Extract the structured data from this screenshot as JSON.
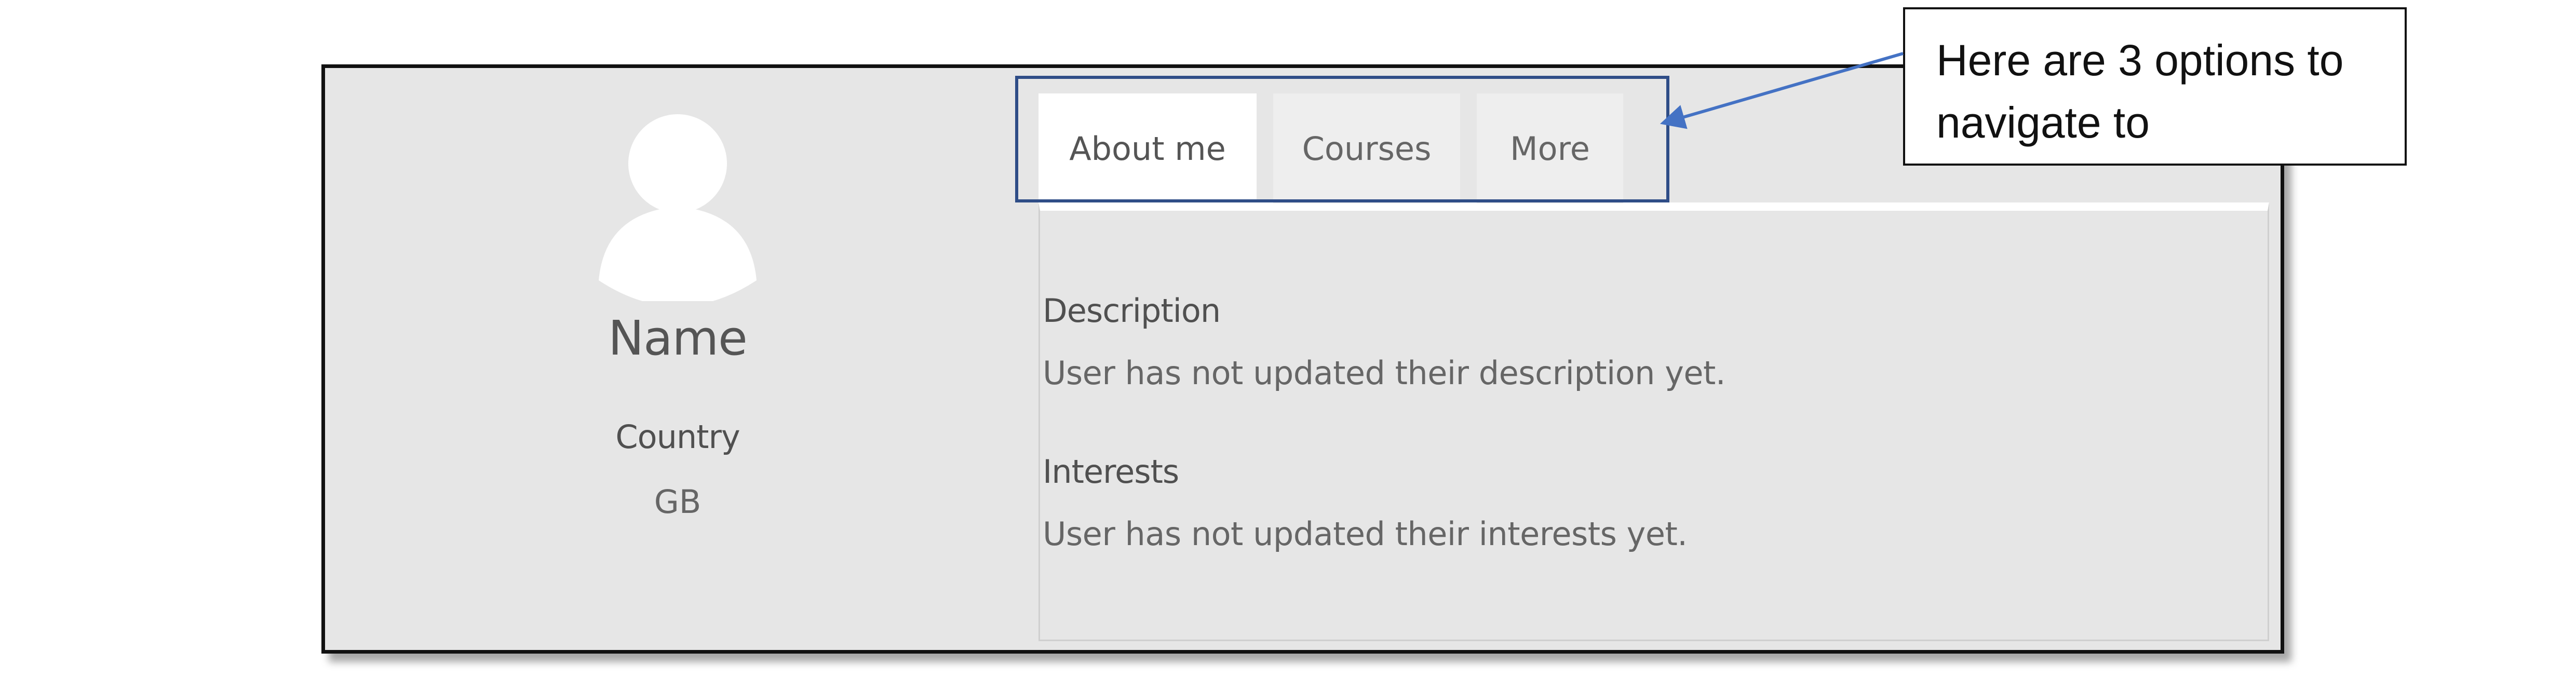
{
  "profile": {
    "name": "Name",
    "country_label": "Country",
    "country_value": "GB"
  },
  "tabs": [
    {
      "label": "About me",
      "active": true
    },
    {
      "label": "Courses",
      "active": false
    },
    {
      "label": "More",
      "active": false
    }
  ],
  "content": {
    "description_heading": "Description",
    "description_text": "User has not updated their description yet.",
    "interests_heading": "Interests",
    "interests_text": "User has not updated their interests yet."
  },
  "callout": {
    "text": "Here are 3 options to navigate to"
  },
  "colors": {
    "panel_bg": "#e6e6e6",
    "highlight_border": "#2f4d87",
    "arrow": "#4472c4",
    "active_tab_bg": "#ffffff",
    "tab_bg": "#eeeeee"
  },
  "icons": {
    "avatar": "default-user-avatar-icon"
  }
}
